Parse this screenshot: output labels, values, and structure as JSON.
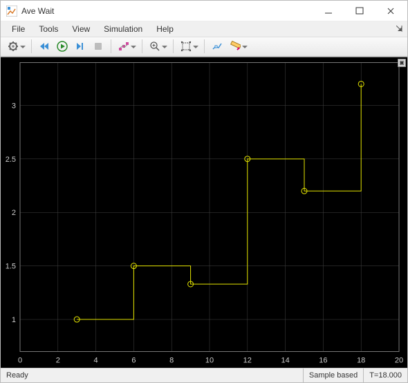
{
  "window": {
    "title": "Ave Wait"
  },
  "menu": {
    "file": "File",
    "tools": "Tools",
    "view": "View",
    "simulation": "Simulation",
    "help": "Help"
  },
  "status": {
    "ready": "Ready",
    "sample": "Sample based",
    "time": "T=18.000"
  },
  "axes": {
    "x": {
      "min": 0,
      "max": 20,
      "ticks": [
        0,
        2,
        4,
        6,
        8,
        10,
        12,
        14,
        16,
        18,
        20
      ]
    },
    "y": {
      "min": 0.7,
      "max": 3.4,
      "ticks": [
        1,
        1.5,
        2,
        2.5,
        3
      ]
    }
  },
  "chart_data": {
    "type": "line",
    "style": "step",
    "title": "Ave Wait",
    "xlabel": "",
    "ylabel": "",
    "xlim": [
      0,
      20
    ],
    "ylim": [
      0.7,
      3.4
    ],
    "points": [
      {
        "x": 3,
        "y": 1.0
      },
      {
        "x": 6,
        "y": 1.5
      },
      {
        "x": 9,
        "y": 1.33
      },
      {
        "x": 12,
        "y": 2.5
      },
      {
        "x": 15,
        "y": 2.2
      },
      {
        "x": 18,
        "y": 3.2
      }
    ],
    "color": "#e6e600"
  }
}
